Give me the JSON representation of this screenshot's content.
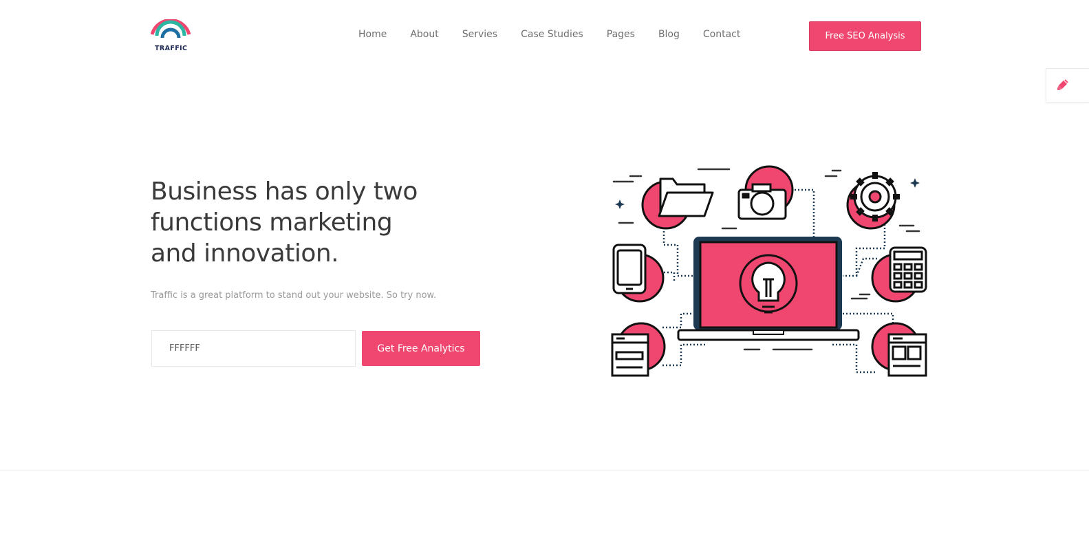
{
  "brand": {
    "name": "TRAFFIC",
    "accent_color": "#ef476f",
    "secondary_color": "#2bb5a2",
    "dark_color": "#1d2b55"
  },
  "nav": {
    "items": [
      {
        "label": "Home"
      },
      {
        "label": "About"
      },
      {
        "label": "Servies"
      },
      {
        "label": "Case Studies"
      },
      {
        "label": "Pages"
      },
      {
        "label": "Blog"
      },
      {
        "label": "Contact"
      }
    ],
    "cta_label": "Free SEO Analysis"
  },
  "side_tool": {
    "icon": "paint-brush-icon"
  },
  "hero": {
    "title": "Business has only two functions marketing and innovation.",
    "subtitle": "Traffic is a great platform to stand out your website. So try now.",
    "input_value": "FFFFFF",
    "button_label": "Get Free Analytics",
    "illustration": {
      "icons": [
        "folder-icon",
        "camera-icon",
        "gear-icon",
        "smartphone-icon",
        "laptop-icon",
        "lightbulb-icon",
        "calculator-icon",
        "browser-window-icon",
        "layout-window-icon"
      ]
    }
  }
}
